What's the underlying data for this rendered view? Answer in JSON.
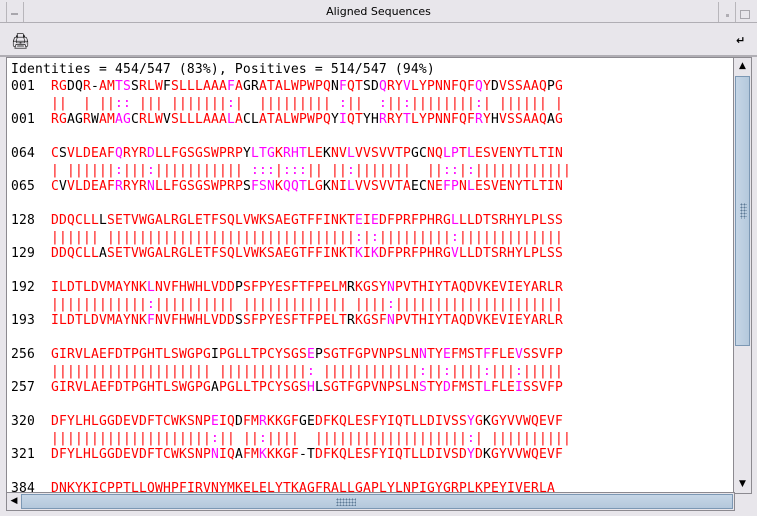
{
  "window": {
    "title": "Aligned Sequences"
  },
  "toolbar": {
    "print_icon": "printer-icon",
    "dock_icon": "undock-arrow-icon"
  },
  "summary": "Identities = 454/547 (83%), Positives = 514/547 (94%)",
  "colors": {
    "identical": "#ff0000",
    "similar": "#ff00ff",
    "mismatch": "#000000"
  },
  "blocks": [
    {
      "num1": "001",
      "seq1": "RGDQR-AMTSSRLWFSLLLAAAFAGRATALWPWPQNFQTSDQRYVLYPNNFQFQYDVSSAAQPG",
      "match": "||  | ||:: ||| |||||||:|  ||||||||| :||  :||:||||||||:| |||||| |",
      "num2": "001",
      "seq2": "RGAGRWAMAGCRLWVSLLLAAALACLATALWPWPQYIQTYHRRYTLYPNNFQFRYHVSSAAQAG"
    },
    {
      "num1": "064",
      "seq1": "CSVLDEAFQRYRDLLFGSGSWPRPYLTGKRHTLEKNVLVVSVVTPGCNQLPTLESVENYTLTIN",
      "match": "| ||||||:|||:||||||||||| :::|:::|| ||:|||||||  ||::|:||||||||||||",
      "num2": "065",
      "seq2": "CVVLDEAFRRYRNLLFGSGSWPRPSFSNKQQTLGKNILVVSVVTAECNEFPNLESVENYTLTIN"
    },
    {
      "num1": "128",
      "seq1": "DDQCLLLSETVWGALRGLETFSQLVWKSAEGTFFINKTEIEDFPRFPHRGLLLDTSRHYLPLSS",
      "match": "|||||| |||||||||||||||||||||||||||||||:|:|||||||||:|||||||||||||",
      "num2": "129",
      "seq2": "DDQCLLASETVWGALRGLETFSQLVWKSAEGTFFINKTKIKDFPRFPHRGVLLDTSRHYLPLSS"
    },
    {
      "num1": "192",
      "seq1": "ILDTLDVMAYNKLNVFHWHLVDDPSFPYESFTFPELMRKGSYNPVTHIYTAQDVKEVIEYARLR",
      "match": "||||||||||||:|||||||||| ||||||||||||| ||||:|||||||||||||||||||||",
      "num2": "193",
      "seq2": "ILDTLDVMAYNKFNVFHWHLVDDSSFPYESFTFPELTRKGSFNPVTHIYTAQDVKEVIEYARLR"
    },
    {
      "num1": "256",
      "seq1": "GIRVLAEFDTPGHTLSWGPGIPGLLTPCYSGSEPSGTFGPVNPSLNNTYEFMSTFFLEVSSVFP",
      "match": "|||||||||||||||||||| |||||||||||: ||||||||||||:||:||||:|||:|||||",
      "num2": "257",
      "seq2": "GIRVLAEFDTPGHTLSWGPGAPGLLTPCYSGSHLSGTFGPVNPSLNSTYDFMSTLFLEISSVFP"
    },
    {
      "num1": "320",
      "seq1": "DFYLHLGGDEVDFTCWKSNPEIQDFMRKKGFGEDFKQLESFYIQTLLDIVSSYGKGYVVWQEVF",
      "match": "||||||||||||||||||||:|| ||:||||  |||||||||||||||||||:| ||||||||||",
      "num2": "321",
      "seq2": "DFYLHLGGDEVDFTCWKSNPNIQAFMKKKGF-TDFKQLESFYIQTLLDIVSDYDKGYVVWQEVF"
    },
    {
      "num1": "384",
      "seq1": "DNKYKICPPTLLQWHPFIRVNYMKELELYTKAGFRALLGAPLYLNPIGYGRPLKPEYIVERLA",
      "match": "",
      "num2": "",
      "seq2": ""
    }
  ]
}
